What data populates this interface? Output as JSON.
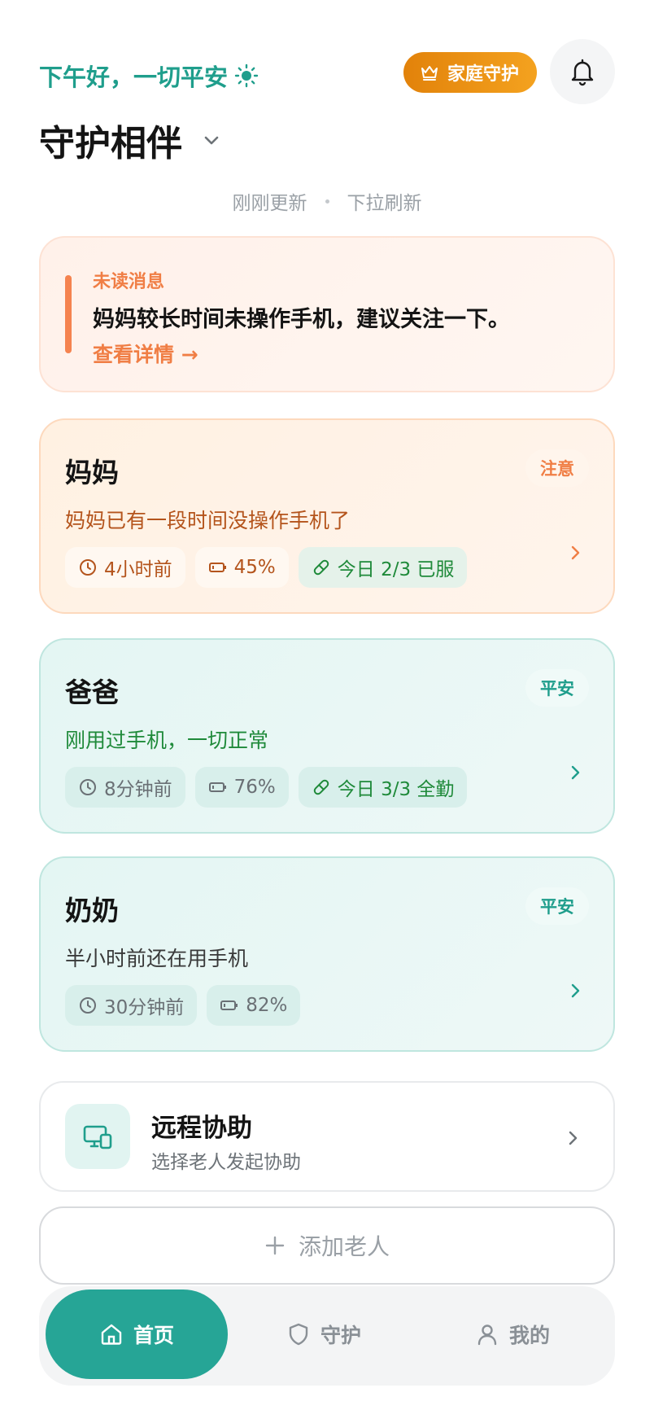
{
  "header": {
    "greeting": "下午好，一切平安",
    "family_button": "家庭守护",
    "title": "守护相伴"
  },
  "refresh": {
    "updated": "刚刚更新",
    "pull": "下拉刷新"
  },
  "alert": {
    "label": "未读消息",
    "text": "妈妈较长时间未操作手机，建议关注一下。",
    "link": "查看详情 →"
  },
  "people": [
    {
      "name": "妈妈",
      "status": "注意",
      "message": "妈妈已有一段时间没操作手机了",
      "last_active": "4小时前",
      "battery": "45%",
      "medication": "今日 2/3 已服"
    },
    {
      "name": "爸爸",
      "status": "平安",
      "message": "刚用过手机，一切正常",
      "last_active": "8分钟前",
      "battery": "76%",
      "medication": "今日 3/3 全勤"
    },
    {
      "name": "奶奶",
      "status": "平安",
      "message": "半小时前还在用手机",
      "last_active": "30分钟前",
      "battery": "82%"
    }
  ],
  "remote": {
    "title": "远程协助",
    "subtitle": "选择老人发起协助"
  },
  "add_button": "添加老人",
  "tabs": [
    {
      "label": "首页",
      "icon": "home-icon"
    },
    {
      "label": "守护",
      "icon": "shield-icon"
    },
    {
      "label": "我的",
      "icon": "user-icon"
    }
  ],
  "colors": {
    "accent": "#26a596",
    "warning": "#f07e45",
    "safe_text": "#1f8a3a"
  }
}
